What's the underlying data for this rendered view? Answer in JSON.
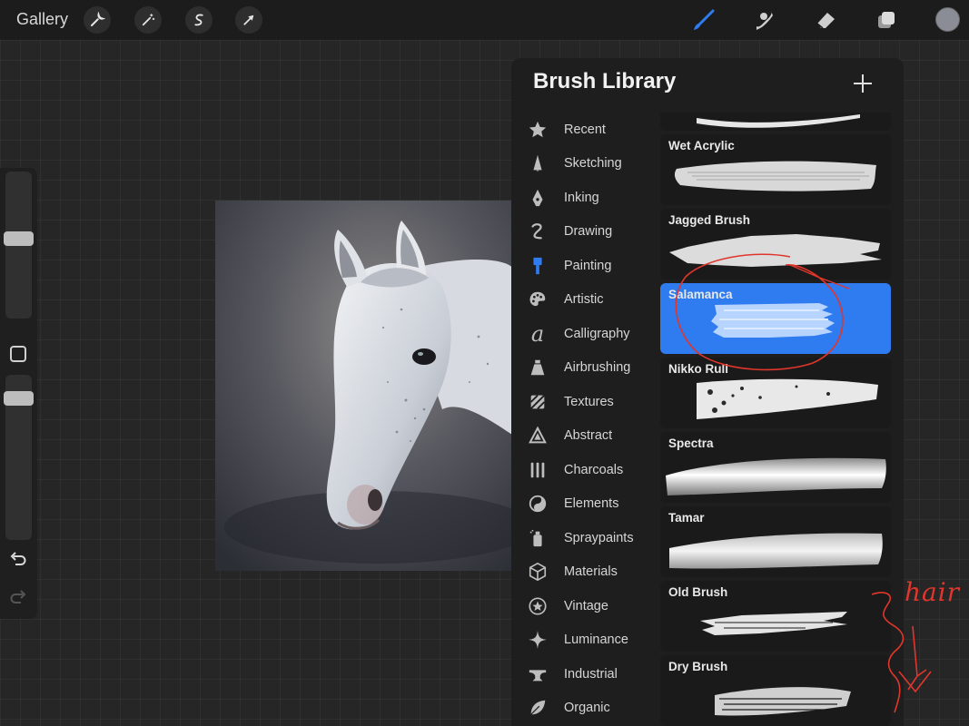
{
  "topbar": {
    "gallery_label": "Gallery",
    "left_tools": [
      "wrench-icon",
      "magic-wand-icon",
      "selection-icon",
      "transform-arrow-icon"
    ],
    "right_tools": [
      "brush-icon",
      "smudge-icon",
      "eraser-icon",
      "layers-icon"
    ],
    "active_tool": "brush-icon",
    "active_color": "#8a8d96",
    "accent_color": "#2f7bf0"
  },
  "sidebar": {
    "size_level": 0.55,
    "opacity_level": 0.0
  },
  "panel": {
    "title": "Brush Library",
    "categories": [
      {
        "label": "Recent",
        "icon": "star-icon"
      },
      {
        "label": "Sketching",
        "icon": "pencil-tip-icon"
      },
      {
        "label": "Inking",
        "icon": "pen-nib-icon"
      },
      {
        "label": "Drawing",
        "icon": "squiggle-icon"
      },
      {
        "label": "Painting",
        "icon": "paint-brush-icon"
      },
      {
        "label": "Artistic",
        "icon": "palette-icon"
      },
      {
        "label": "Calligraphy",
        "icon": "calligraphy-a-icon"
      },
      {
        "label": "Airbrushing",
        "icon": "airbrush-icon"
      },
      {
        "label": "Textures",
        "icon": "texture-icon"
      },
      {
        "label": "Abstract",
        "icon": "triangle-icon"
      },
      {
        "label": "Charcoals",
        "icon": "charcoal-icon"
      },
      {
        "label": "Elements",
        "icon": "yin-yang-icon"
      },
      {
        "label": "Spraypaints",
        "icon": "spray-can-icon"
      },
      {
        "label": "Materials",
        "icon": "cube-icon"
      },
      {
        "label": "Vintage",
        "icon": "vintage-star-icon"
      },
      {
        "label": "Luminance",
        "icon": "sparkle-icon"
      },
      {
        "label": "Industrial",
        "icon": "anvil-icon"
      },
      {
        "label": "Organic",
        "icon": "leaf-icon"
      }
    ],
    "active_category": "Painting",
    "brushes": [
      {
        "name": ""
      },
      {
        "name": "Wet Acrylic"
      },
      {
        "name": "Jagged Brush"
      },
      {
        "name": "Salamanca",
        "selected": true
      },
      {
        "name": "Nikko Rull"
      },
      {
        "name": "Spectra"
      },
      {
        "name": "Tamar"
      },
      {
        "name": "Old Brush"
      },
      {
        "name": "Dry Brush"
      }
    ]
  },
  "annotation": {
    "handwritten_note": "hair",
    "ink_color": "#e0362b"
  }
}
